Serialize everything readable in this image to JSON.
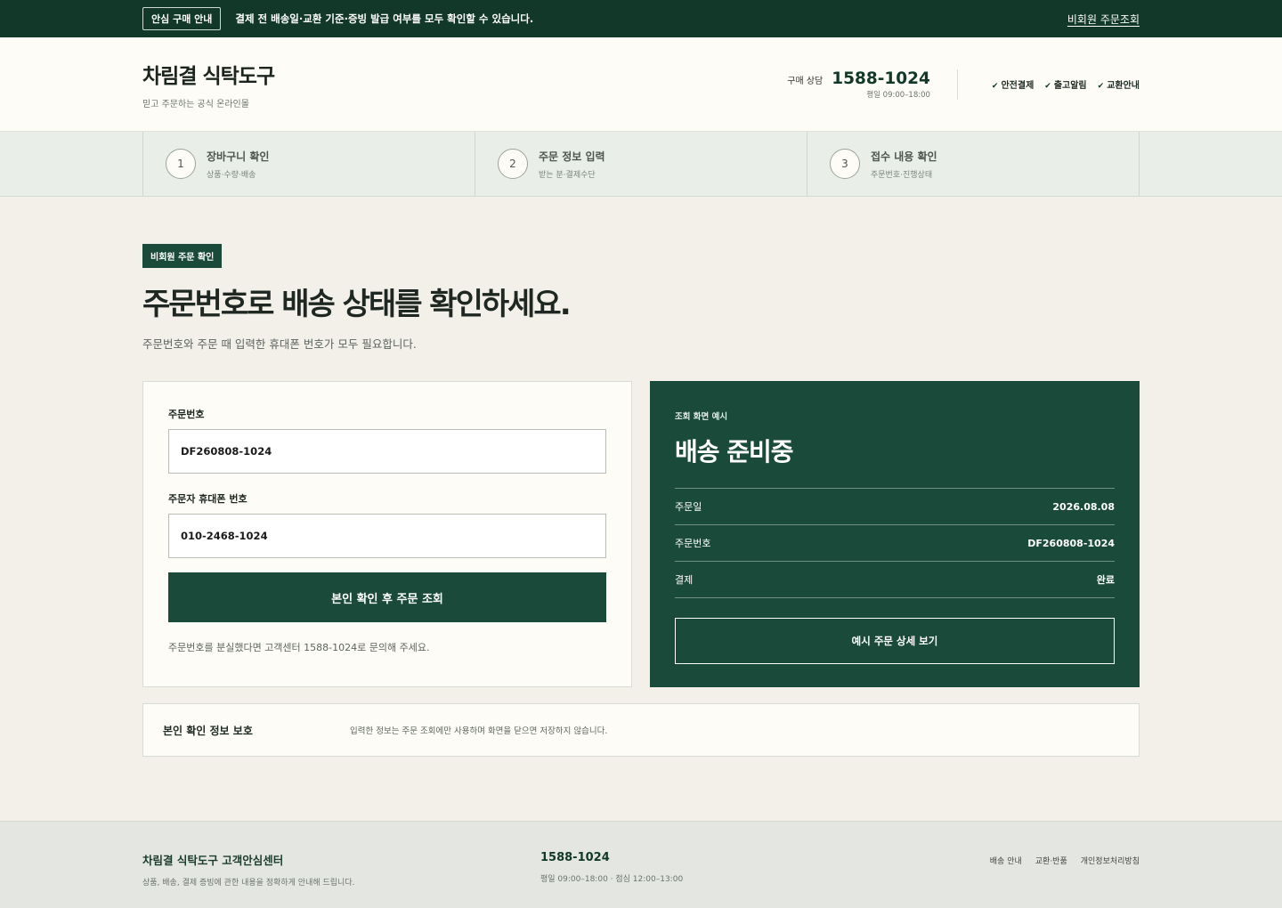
{
  "topbar": {
    "badge": "안심 구매 안내",
    "message": "결제 전 배송일·교환 기준·증빙 발급 여부를 모두 확인할 수 있습니다.",
    "link": "비회원 주문조회"
  },
  "header": {
    "brand": "차림결 식탁도구",
    "tagline": "믿고 주문하는 공식 온라인몰",
    "contact_label": "구매 상담",
    "phone": "1588-1024",
    "hours": "평일 09:00–18:00",
    "badges": [
      "안전결제",
      "출고알림",
      "교환안내"
    ]
  },
  "steps": [
    {
      "num": "1",
      "title": "장바구니 확인",
      "sub": "상품·수량·배송"
    },
    {
      "num": "2",
      "title": "주문 정보 입력",
      "sub": "받는 분·결제수단"
    },
    {
      "num": "3",
      "title": "접수 내용 확인",
      "sub": "주문번호·진행상태"
    }
  ],
  "main": {
    "pill": "비회원 주문 확인",
    "headline": "주문번호로 배송 상태를 확인하세요.",
    "desc": "주문번호와 주문 때 입력한 휴대폰 번호가 모두 필요합니다."
  },
  "form": {
    "order_label": "주문번호",
    "order_value": "DF260808-1024",
    "phone_label": "주문자 휴대폰 번호",
    "phone_value": "010-2468-1024",
    "submit": "본인 확인 후 주문 조회",
    "help": "주문번호를 분실했다면 고객센터 1588-1024로 문의해 주세요."
  },
  "preview": {
    "caption": "조회 화면 예시",
    "status": "배송 준비중",
    "rows": [
      {
        "label": "주문일",
        "value": "2026.08.08"
      },
      {
        "label": "주문번호",
        "value": "DF260808-1024"
      },
      {
        "label": "결제",
        "value": "완료"
      }
    ],
    "button": "예시 주문 상세 보기"
  },
  "privacy": {
    "title": "본인 확인 정보 보호",
    "desc": "입력한 정보는 주문 조회에만 사용하며 화면을 닫으면 저장하지 않습니다."
  },
  "footer": {
    "title": "차림결 식탁도구 고객안심센터",
    "sub": "상품, 배송, 결제 증빙에 관한 내용을 정확하게 안내해 드립니다.",
    "phone": "1588-1024",
    "hours": "평일 09:00–18:00 · 점심 12:00–13:00",
    "links": [
      "배송 안내",
      "교환·반품",
      "개인정보처리방침"
    ]
  },
  "colors": {
    "primary": "#1a4a3a",
    "topbar": "#12382a",
    "background": "#f3f0ea"
  }
}
